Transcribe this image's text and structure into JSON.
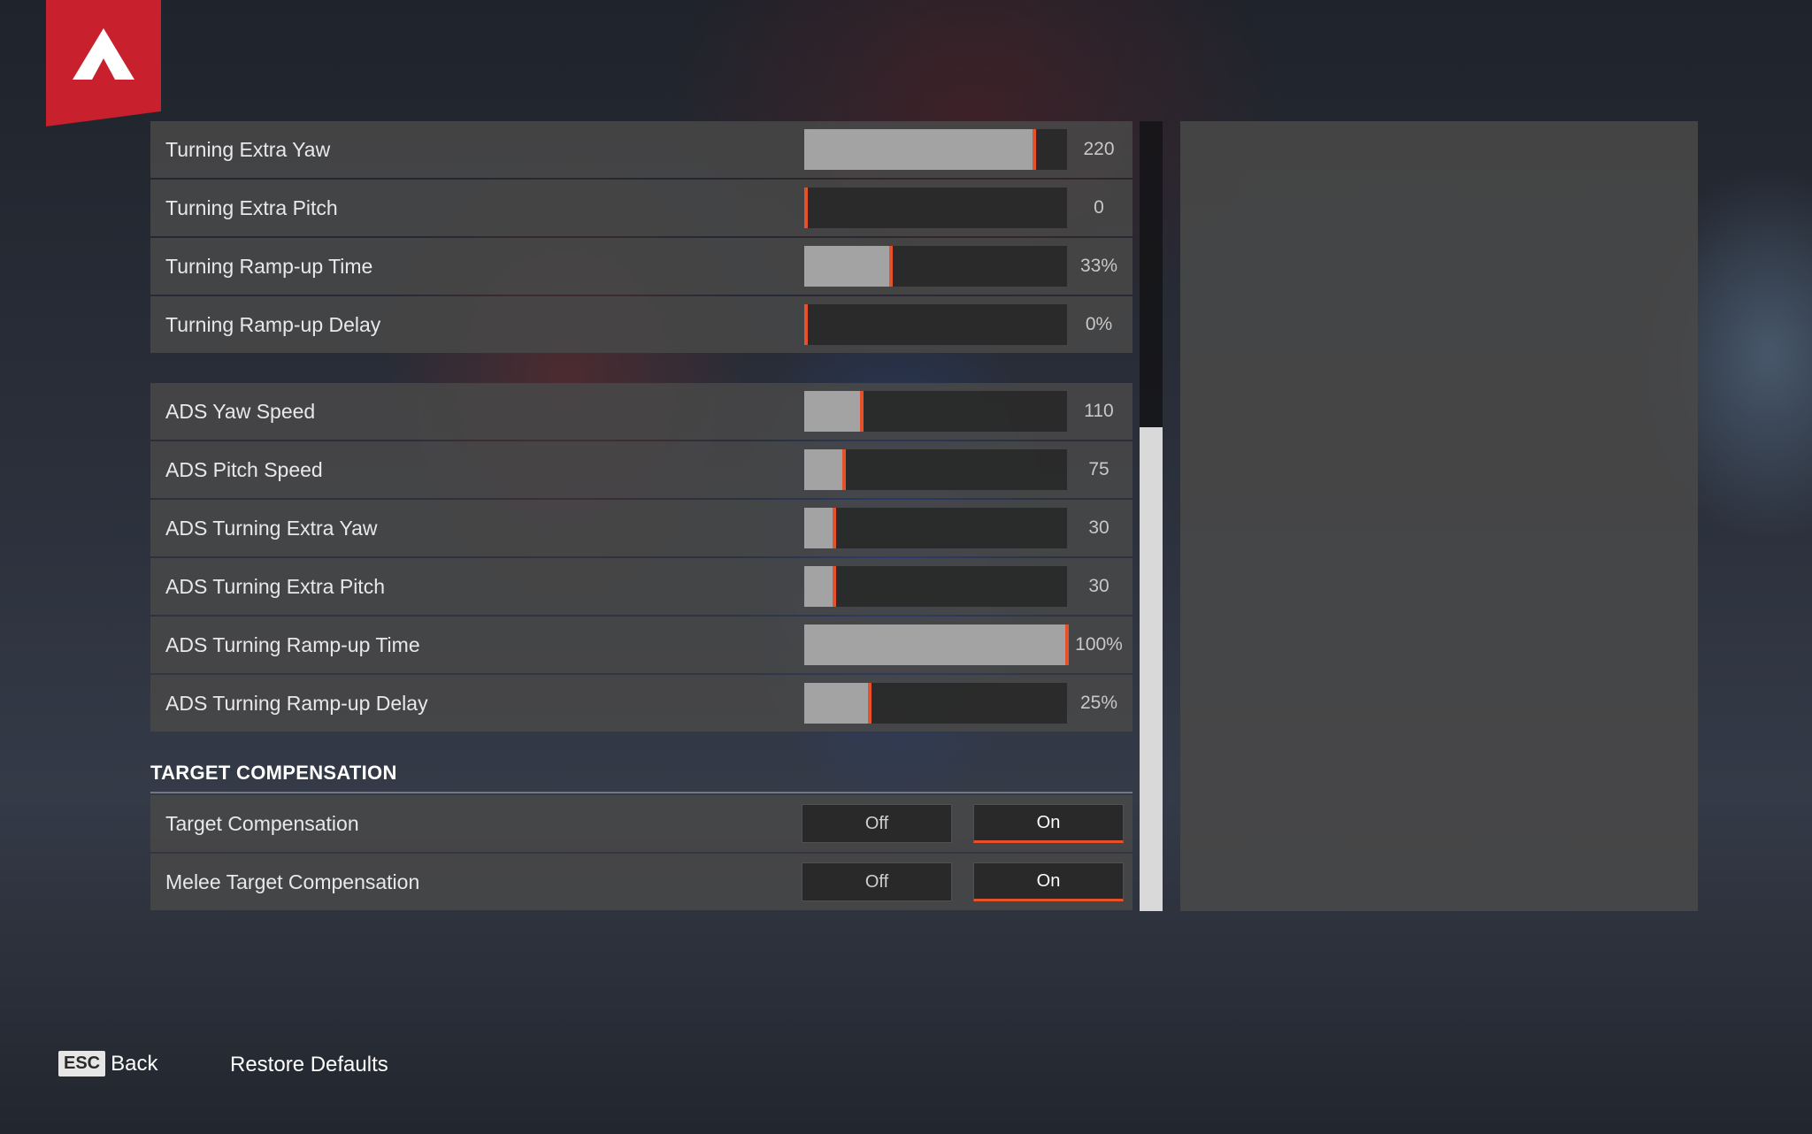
{
  "sliders_group1": [
    {
      "label": "Turning Extra Yaw",
      "value": "220",
      "fill": 0.875
    },
    {
      "label": "Turning Extra Pitch",
      "value": "0",
      "fill": 0.0
    },
    {
      "label": "Turning Ramp-up Time",
      "value": "33%",
      "fill": 0.33
    },
    {
      "label": "Turning Ramp-up Delay",
      "value": "0%",
      "fill": 0.0
    }
  ],
  "sliders_group2": [
    {
      "label": "ADS Yaw Speed",
      "value": "110",
      "fill": 0.22
    },
    {
      "label": "ADS Pitch Speed",
      "value": "75",
      "fill": 0.15
    },
    {
      "label": "ADS Turning Extra Yaw",
      "value": "30",
      "fill": 0.115
    },
    {
      "label": "ADS Turning Extra Pitch",
      "value": "30",
      "fill": 0.115
    },
    {
      "label": "ADS Turning Ramp-up Time",
      "value": "100%",
      "fill": 1.0
    },
    {
      "label": "ADS Turning Ramp-up Delay",
      "value": "25%",
      "fill": 0.25
    }
  ],
  "target_section": {
    "title": "TARGET COMPENSATION",
    "toggles": [
      {
        "label": "Target Compensation",
        "off_label": "Off",
        "on_label": "On",
        "selected": "On"
      },
      {
        "label": "Melee Target Compensation",
        "off_label": "Off",
        "on_label": "On",
        "selected": "On"
      }
    ]
  },
  "footer": {
    "back_key": "ESC",
    "back_label": "Back",
    "restore_label": "Restore Defaults"
  },
  "colors": {
    "accent": "#e8502a",
    "logo_red": "#c8202d",
    "slider_fill": "#a3a3a3"
  }
}
